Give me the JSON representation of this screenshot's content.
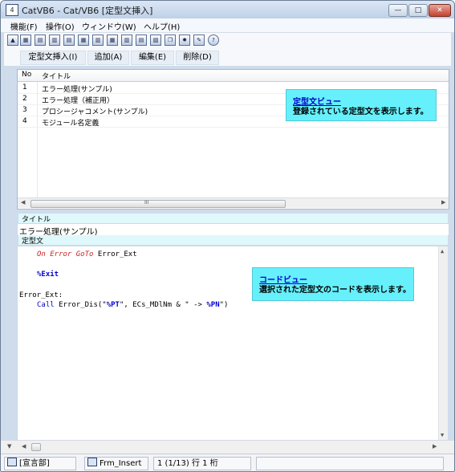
{
  "window": {
    "title": "CatVB6 - Cat/VB6 [定型文挿入]",
    "app_icon_glyph": "4",
    "minimize_label": "—",
    "maximize_label": "□",
    "close_label": "✕"
  },
  "menu": [
    "機能(F)",
    "操作(O)",
    "ウィンドウ(W)",
    "ヘルプ(H)"
  ],
  "toolbar_icons": [
    "pin-icon",
    "export-icon",
    "doc-icon",
    "doc2-icon",
    "doc3-icon",
    "doc4-icon",
    "grid-icon",
    "grid2-icon",
    "grid3-icon",
    "table-icon",
    "image-icon",
    "copy-icon",
    "gear-icon",
    "brush-icon",
    "help-icon"
  ],
  "toolbar_glyphs": [
    "▲",
    "▦",
    "▤",
    "▥",
    "▤",
    "▦",
    "▥",
    "▦",
    "▥",
    "▤",
    "▧",
    "❐",
    "✹",
    "✎",
    "?"
  ],
  "commands": [
    "定型文挿入(I)",
    "追加(A)",
    "編集(E)",
    "削除(D)"
  ],
  "list": {
    "headers": [
      "No",
      "タイトル"
    ],
    "rows": [
      {
        "no": "1",
        "title": "エラー処理(サンプル)"
      },
      {
        "no": "2",
        "title": "エラー処理（補正用）"
      },
      {
        "no": "3",
        "title": "プロシージャコメント(サンプル)"
      },
      {
        "no": "4",
        "title": "モジュール名定義"
      }
    ]
  },
  "callout_list": {
    "head": "定型文ビュー",
    "body": "登録されている定型文を表示します。"
  },
  "scroll_mid_glyph": "III",
  "title_band_label": "タイトル",
  "title_value": "エラー処理(サンプル)",
  "body_band_label": "定型文",
  "code": {
    "line1": "On Error GoTo",
    "line1_rest": " Error_Ext",
    "line2": "%Exit",
    "line3": "Error_Ext:",
    "line4_a": "Call",
    "line4_b": " Error_Dis(\"",
    "line4_c": "%PT",
    "line4_d": "\", ECs_MDlNm & \" -> ",
    "line4_e": "%PN",
    "line4_f": "\")"
  },
  "callout_code": {
    "head": "コードビュー",
    "body": "選択された定型文のコードを表示します。"
  },
  "status": {
    "section": "[宣言部]",
    "form": "Frm_Insert",
    "position": "1 (1/13) 行 1 桁"
  }
}
